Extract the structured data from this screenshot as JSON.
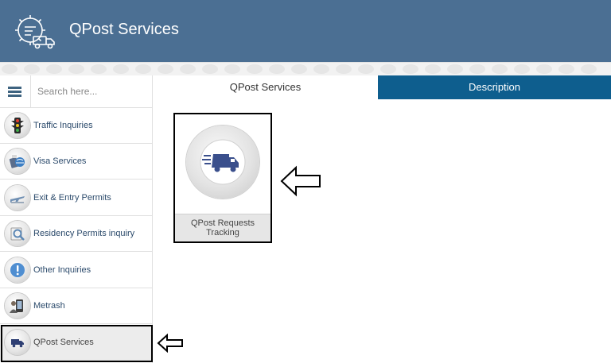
{
  "header": {
    "title": "QPost Services",
    "background": "#4b6f93"
  },
  "search": {
    "placeholder": "Search here..."
  },
  "sidebar": {
    "items": [
      {
        "label": "Traffic Inquiries",
        "icon": "traffic-light-icon"
      },
      {
        "label": "Visa Services",
        "icon": "visa-passport-icon"
      },
      {
        "label": "Exit & Entry Permits",
        "icon": "airplane-icon"
      },
      {
        "label": "Residency Permits inquiry",
        "icon": "residency-search-icon"
      },
      {
        "label": "Other Inquiries",
        "icon": "exclamation-icon"
      },
      {
        "label": "Metrash",
        "icon": "metrash-icon"
      },
      {
        "label": "QPost Services",
        "icon": "delivery-truck-icon",
        "active": true
      }
    ]
  },
  "tabs": {
    "left": "QPost Services",
    "right": "Description",
    "active_color": "#0e5e8e"
  },
  "tile": {
    "label": "QPost Requests Tracking",
    "icon": "delivery-truck-icon"
  }
}
